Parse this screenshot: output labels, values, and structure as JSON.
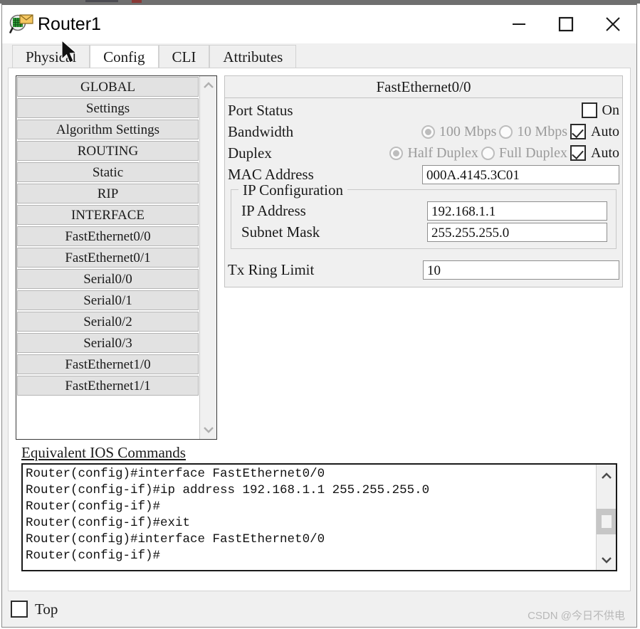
{
  "window": {
    "title": "Router1",
    "icon": "packet-tracer-device-icon",
    "controls": {
      "minimize": "minimize-icon",
      "maximize": "maximize-icon",
      "close": "close-icon"
    }
  },
  "tabs": [
    {
      "label": "Physical",
      "active": false
    },
    {
      "label": "Config",
      "active": true
    },
    {
      "label": "CLI",
      "active": false
    },
    {
      "label": "Attributes",
      "active": false
    }
  ],
  "sidebar": {
    "items": [
      {
        "label": "GLOBAL"
      },
      {
        "label": "Settings"
      },
      {
        "label": "Algorithm Settings"
      },
      {
        "label": "ROUTING"
      },
      {
        "label": "Static"
      },
      {
        "label": "RIP"
      },
      {
        "label": "INTERFACE"
      },
      {
        "label": "FastEthernet0/0"
      },
      {
        "label": "FastEthernet0/1"
      },
      {
        "label": "Serial0/0"
      },
      {
        "label": "Serial0/1"
      },
      {
        "label": "Serial0/2"
      },
      {
        "label": "Serial0/3"
      },
      {
        "label": "FastEthernet1/0"
      },
      {
        "label": "FastEthernet1/1"
      }
    ],
    "scroll_up": "chevron-up-icon",
    "scroll_down": "chevron-down-icon"
  },
  "config": {
    "interface_title": "FastEthernet0/0",
    "port_status": {
      "label": "Port Status",
      "on_label": "On",
      "checked": false
    },
    "bandwidth": {
      "label": "Bandwidth",
      "option_100": "100 Mbps",
      "option_10": "10 Mbps",
      "selected": "100 Mbps",
      "auto_label": "Auto",
      "auto_checked": true
    },
    "duplex": {
      "label": "Duplex",
      "option_half": "Half Duplex",
      "option_full": "Full Duplex",
      "selected": "Half Duplex",
      "auto_label": "Auto",
      "auto_checked": true
    },
    "mac_address": {
      "label": "MAC Address",
      "value": "000A.4145.3C01"
    },
    "ip_configuration": {
      "legend": "IP Configuration",
      "ip_address": {
        "label": "IP Address",
        "value": "192.168.1.1"
      },
      "subnet_mask": {
        "label": "Subnet Mask",
        "value": "255.255.255.0"
      }
    },
    "tx_ring_limit": {
      "label": "Tx Ring Limit",
      "value": "10"
    }
  },
  "ios": {
    "label": "Equivalent IOS Commands",
    "lines": [
      "Router(config)#interface FastEthernet0/0",
      "Router(config-if)#ip address 192.168.1.1 255.255.255.0",
      "Router(config-if)#",
      "Router(config-if)#exit",
      "Router(config)#interface FastEthernet0/0",
      "Router(config-if)#"
    ],
    "scroll_up": "chevron-up-icon",
    "scroll_down": "chevron-down-icon"
  },
  "bottom": {
    "top_checkbox": {
      "label": "Top",
      "checked": false
    },
    "watermark": "CSDN @今日不供电"
  },
  "colors": {
    "window_bg": "#f0f0f0",
    "panel_bg": "#ffffff",
    "sidebar_item": "#e2e2e2",
    "disabled_text": "#9b9b9b",
    "border": "#c2c2c2",
    "watermark": "#b8b8b8"
  }
}
